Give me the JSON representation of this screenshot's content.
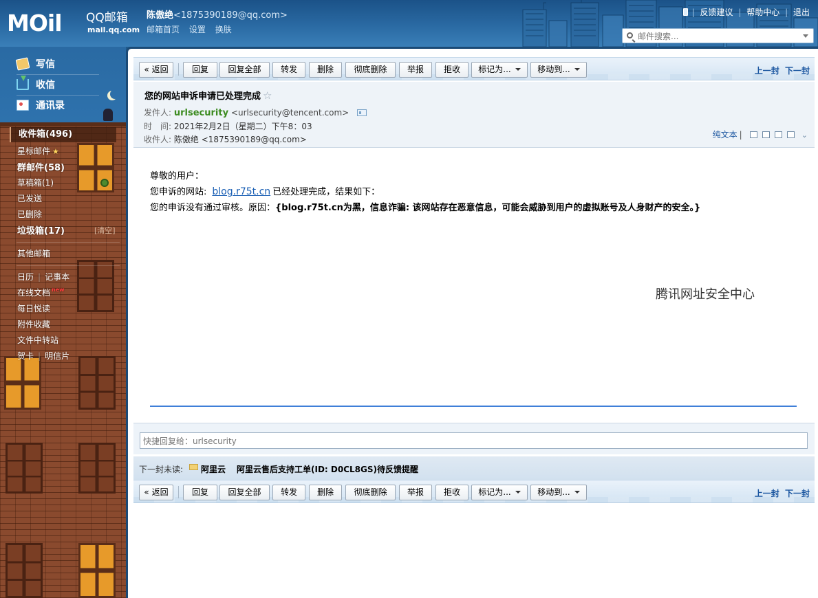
{
  "header": {
    "logo": {
      "moil": "MOil",
      "qqmail": "QQ邮箱",
      "domain": "mail.qq.com"
    },
    "user": {
      "name": "陈傲绝",
      "email": "<1875390189@qq.com>"
    },
    "user_links": [
      "邮箱首页",
      "设置",
      "换肤"
    ],
    "top_links": [
      "反馈建议",
      "帮助中心",
      "退出"
    ],
    "search": {
      "placeholder": "邮件搜索..."
    }
  },
  "sidebar": {
    "actions": [
      "写信",
      "收信",
      "通讯录"
    ],
    "folders": {
      "inbox": "收件箱(496)",
      "starred": "星标邮件",
      "group": "群邮件(58)",
      "drafts": "草稿箱(1)",
      "sent": "已发送",
      "deleted": "已删除",
      "spam": "垃圾箱(17)",
      "spam_clear": "[清空]",
      "other": "其他邮箱",
      "calendar": "日历",
      "notes": "记事本",
      "docs": "在线文档",
      "docs_badge": "new",
      "daily": "每日悦读",
      "attachments": "附件收藏",
      "transfer": "文件中转站",
      "cards": "贺卡",
      "postcards": "明信片"
    }
  },
  "toolbar": {
    "back": "« 返回",
    "reply": "回复",
    "reply_all": "回复全部",
    "forward": "转发",
    "delete": "删除",
    "delete_forever": "彻底删除",
    "report": "举报",
    "reject": "拒收",
    "mark_as": "标记为...",
    "move_to": "移动到...",
    "prev": "上一封",
    "next": "下一封"
  },
  "mail": {
    "subject": "您的网站申诉申请已处理完成",
    "from_label": "发件人:",
    "from_name": "urlsecurity",
    "from_addr": "<urlsecurity@tencent.com>",
    "time_label": "时　间:",
    "time": "2021年2月2日（星期二）下午8：03",
    "to_label": "收件人:",
    "to": "陈傲绝 <1875390189@qq.com>",
    "plain_text": "纯文本"
  },
  "body": {
    "greeting": "尊敬的用户：",
    "line2_prefix": "您申诉的网站:",
    "line2_link": "blog.r75t.cn",
    "line2_suffix": "已经处理完成，结果如下：",
    "line3_prefix": "您的申诉没有通过审核。原因：",
    "line3_reason": "{blog.r75t.cn为黑，信息诈骗: 该网站存在恶意信息，可能会威胁到用户的虚拟账号及人身财产的安全。}",
    "signature": "腾讯网址安全中心"
  },
  "quick_reply": {
    "placeholder": "快捷回复给：urlsecurity"
  },
  "next_unread": {
    "label": "下一封未读:",
    "from": "阿里云",
    "subject": "阿里云售后支持工单(ID: D0CL8GS)待反馈提醒"
  }
}
